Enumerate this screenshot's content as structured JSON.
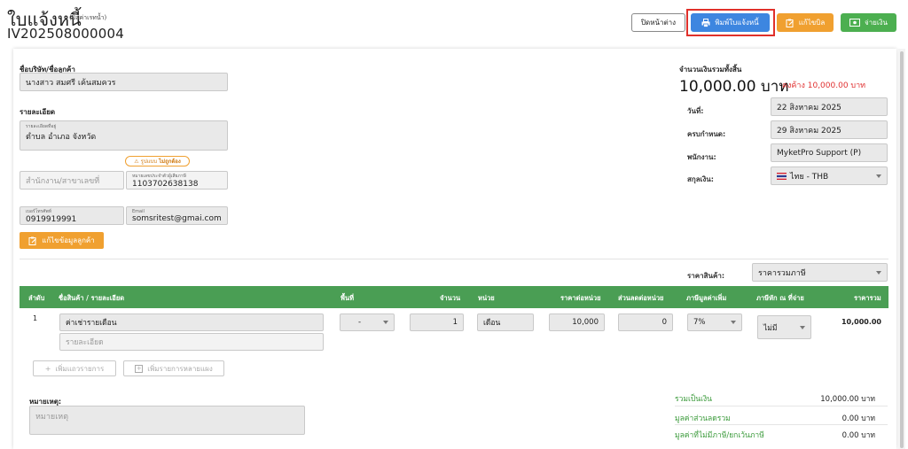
{
  "header": {
    "title": "ใบแจ้งหนี้",
    "subtitle": "(บิลค่าเรทน้ำ)",
    "doc_number": "IV202508000004",
    "buttons": {
      "close": "ปิดหน้าต่าง",
      "print": "พิมพ์ใบแจ้งหนี้",
      "edit_bill": "แก้ไขบิล",
      "pay": "จ่ายเงิน"
    }
  },
  "customer": {
    "company_label": "ชื่อบริษัท/ชื่อลูกค้า",
    "company_value": "นางสาว สมศรี เค้นสมควร",
    "details_label": "รายละเอียด",
    "address_label": "รายละเอียดที่อยู่",
    "address_value": "ตำบล อำเภอ จังหวัด",
    "format_badge_prefix": "รูปแบบ",
    "format_badge_status": "ไม่ถูกต้อง",
    "branch_placeholder": "สำนักงาน/สาขาเลขที่",
    "taxid_label": "หมายเลขประจำตัวผู้เสียภาษี",
    "taxid_value": "1103702638138",
    "phone_label": "เบอร์โทรศัพท์",
    "phone_value": "0919919991",
    "email_label": "Email",
    "email_value": "somsritest@gmai.com",
    "edit_customer_button": "แก้ไขข้อมูลลูกค้า"
  },
  "summary": {
    "total_label": "จำนวนเงินรวมทั้งสิ้น",
    "total_amount": "10,000.00 บาท",
    "owed": "คงค้าง 10,000.00 บาท",
    "date_label": "วันที่:",
    "date_value": "22 สิงหาคม 2025",
    "due_label": "ครบกำหนด:",
    "due_value": "29 สิงหาคม 2025",
    "staff_label": "พนักงาน:",
    "staff_value": "MyketPro Support (P)",
    "currency_label": "สกุลเงิน:",
    "currency_value": "ไทย - THB",
    "price_label": "ราคาสินค้า:",
    "price_value": "ราคารวมภาษี"
  },
  "table": {
    "headers": {
      "no": "ลำดับ",
      "item": "ชื่อสินค้า / รายละเอียด",
      "area": "พื้นที่",
      "qty": "จำนวน",
      "unit": "หน่วย",
      "unit_price": "ราคาต่อหน่วย",
      "discount": "ส่วนลดต่อหน่วย",
      "vat": "ภาษีมูลค่าเพิ่ม",
      "wht": "ภาษีหัก ณ ที่จ่าย",
      "total": "ราคารวม"
    },
    "rows": [
      {
        "no": "1",
        "item": "ค่าเช่ารายเดือน",
        "detail_placeholder": "รายละเอียด",
        "area": "-",
        "qty": "1",
        "unit": "เดือน",
        "unit_price": "10,000",
        "discount": "0",
        "vat": "7%",
        "wht": "ไม่มี",
        "total": "10,000.00"
      }
    ],
    "add_row": "เพิ่มแถวรายการ",
    "add_multi": "เพิ่มรายการหลายแผง"
  },
  "notes": {
    "label": "หมายเหตุ:",
    "placeholder": "หมายเหตุ"
  },
  "totals": {
    "subtotal_label": "รวมเป็นเงิน",
    "subtotal_value": "10,000.00 บาท",
    "discount_label": "มูลค่าส่วนลดรวม",
    "discount_value": "0.00 บาท",
    "nonvat_label": "มูลค่าที่ไม่มีภาษี/ยกเว้นภาษี",
    "nonvat_value": "0.00 บาท"
  },
  "colors": {
    "primary": "#3d86e0",
    "warning": "#f0a030",
    "success": "#4caf50",
    "table_header": "#4a9e54",
    "danger": "#e03030"
  }
}
